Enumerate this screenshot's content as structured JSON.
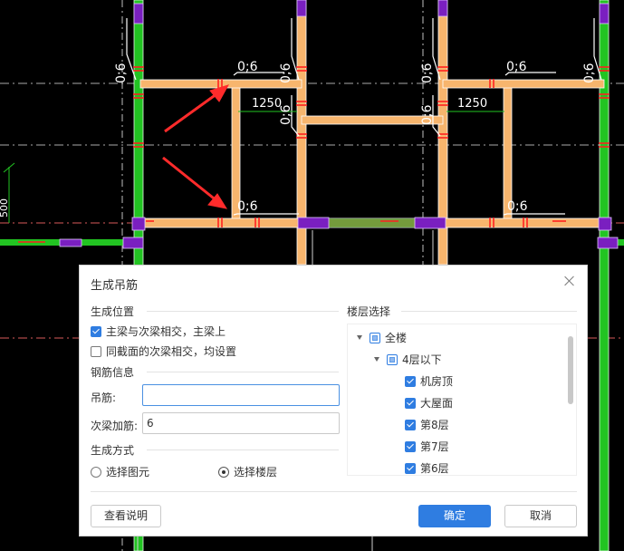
{
  "drawing": {
    "annotations": [
      "0;6",
      "0;6",
      "0;6",
      "0;6",
      "0;6",
      "0;6",
      "0;6",
      "0;6",
      "0;6",
      "0;6"
    ],
    "dimension_left": "1250",
    "dimension_right": "1250",
    "edge_label": "500"
  },
  "dialog": {
    "title": "生成吊筋",
    "section_position": "生成位置",
    "opt_main_secondary": "主梁与次梁相交，主梁上",
    "opt_same_section": "同截面的次梁相交，均设置",
    "section_rebar": "钢筋信息",
    "hanger_label": "吊筋:",
    "hanger_value": "",
    "extra_label": "次梁加筋:",
    "extra_value": "6",
    "section_method": "生成方式",
    "method_element": "选择图元",
    "method_floor": "选择楼层",
    "floor_section": "楼层选择",
    "tree": {
      "all": "全楼",
      "group": "4层以下",
      "floors": [
        "机房顶",
        "大屋面",
        "第8层",
        "第7层",
        "第6层"
      ]
    },
    "help_button": "查看说明",
    "ok_button": "确定",
    "cancel_button": "取消"
  },
  "colors": {
    "beam_main": "#f7b56d",
    "beam_green": "#22c422",
    "column": "#7a1fc0",
    "accent": "#2f7de1",
    "arrow": "#ff2b2b"
  }
}
